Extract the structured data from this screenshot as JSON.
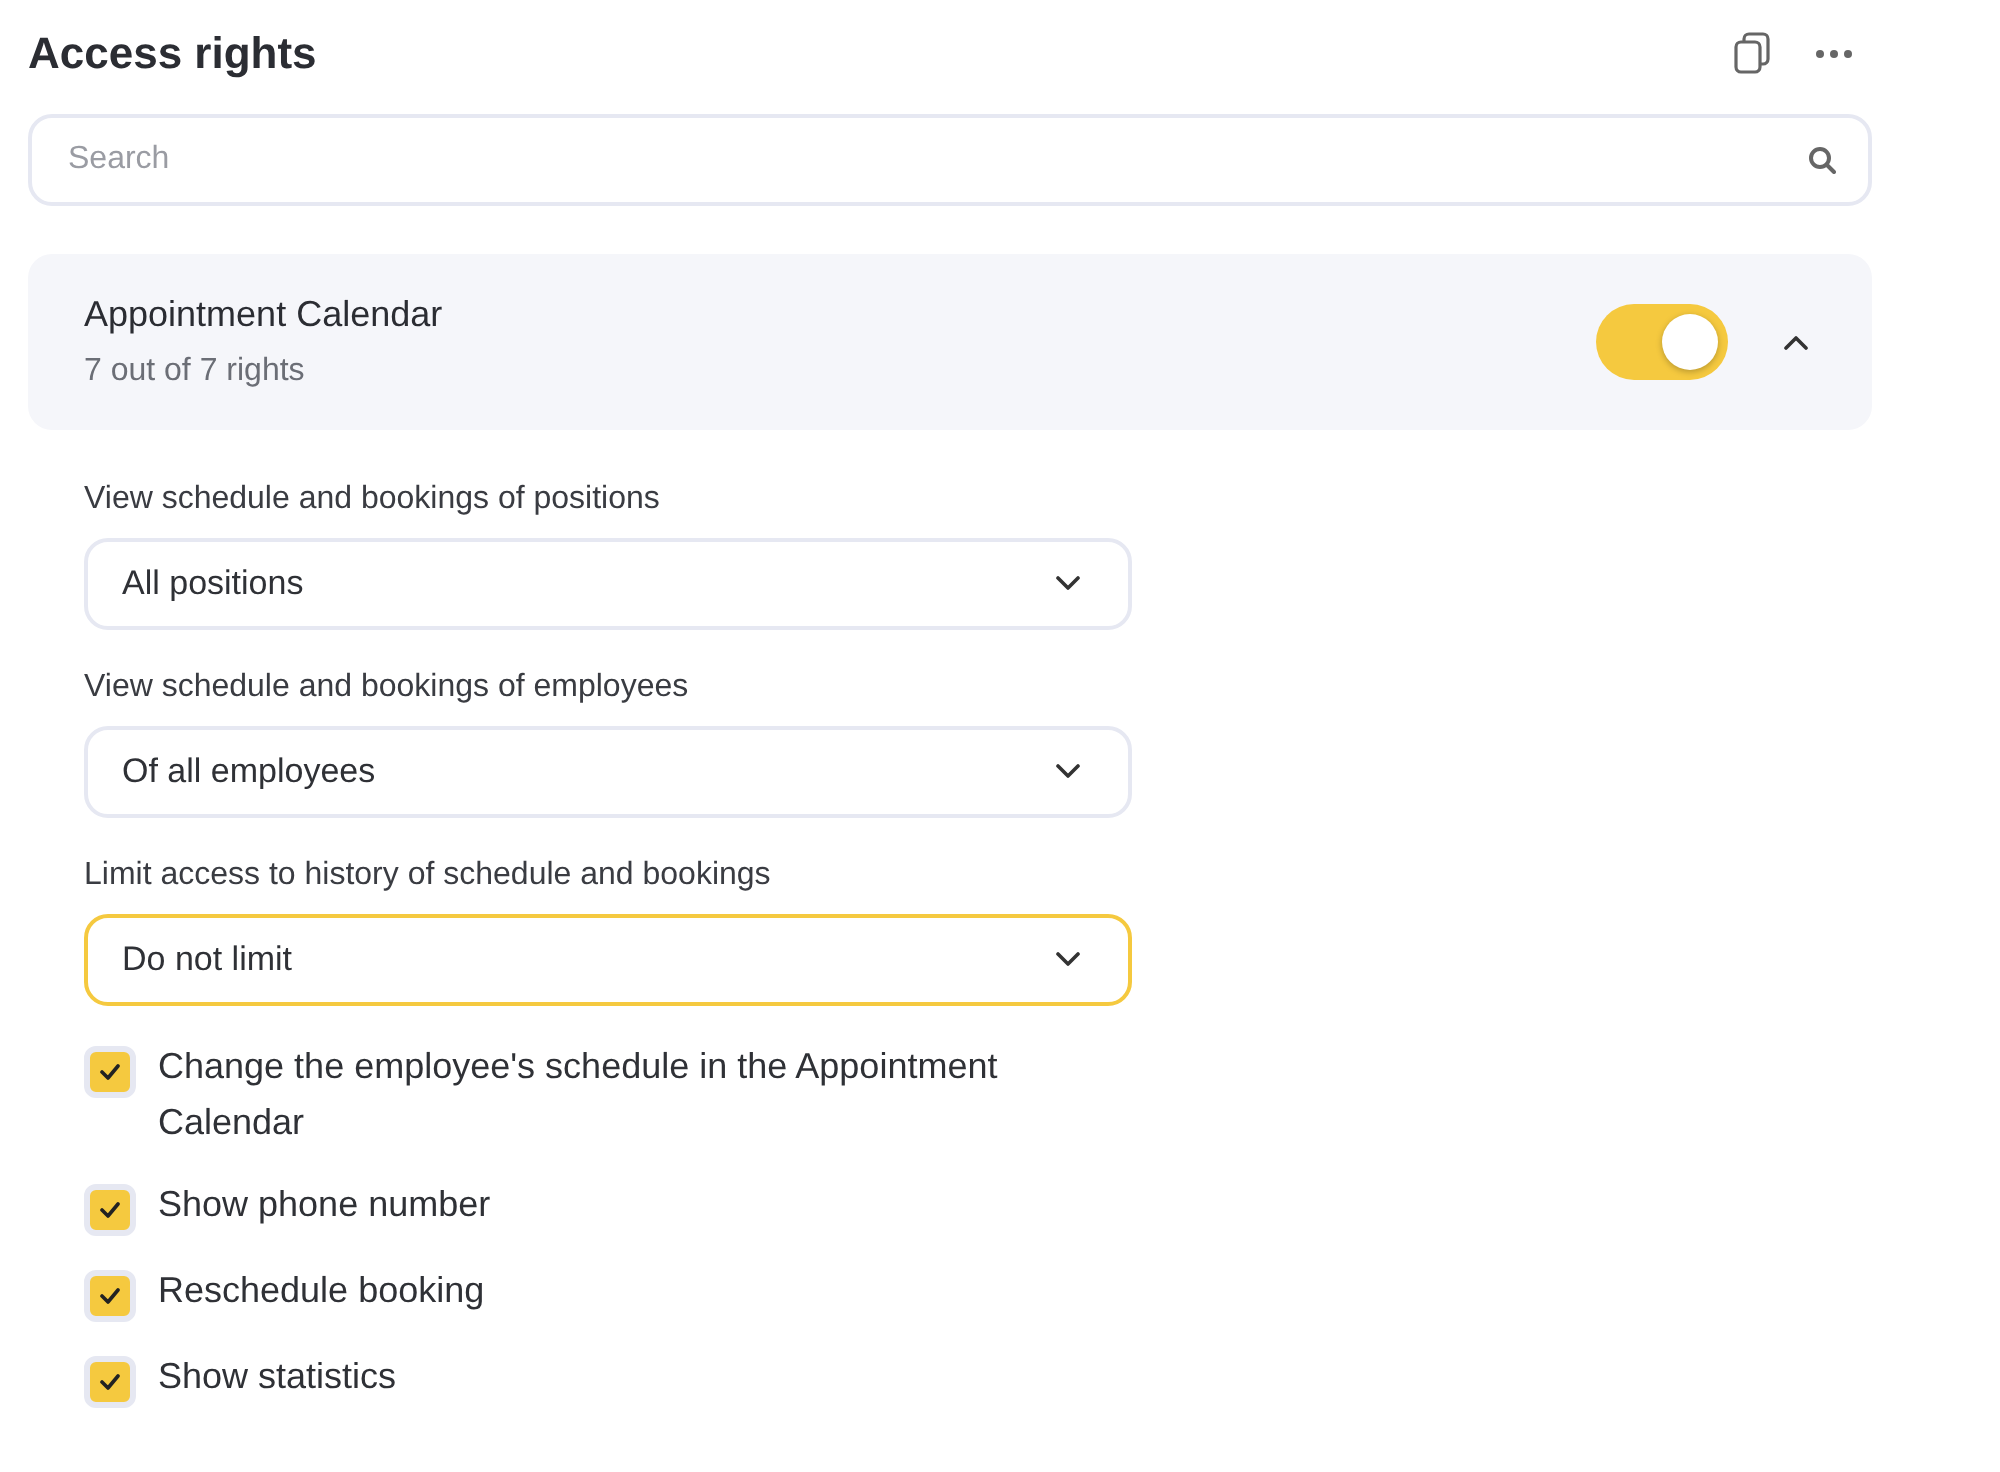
{
  "title": "Access rights",
  "search": {
    "placeholder": "Search"
  },
  "section": {
    "title": "Appointment Calendar",
    "subtitle": "7 out of 7 rights",
    "on": true,
    "expanded": true,
    "selects": [
      {
        "label": "View schedule and bookings of positions",
        "value": "All positions",
        "focused": false
      },
      {
        "label": "View schedule and bookings of employees",
        "value": "Of all employees",
        "focused": false
      },
      {
        "label": "Limit access to history of schedule and bookings",
        "value": "Do not limit",
        "focused": true
      }
    ],
    "checks": [
      {
        "label": "Change the employee's schedule in the Appointment Calendar",
        "checked": true
      },
      {
        "label": "Show phone number",
        "checked": true
      },
      {
        "label": "Reschedule booking",
        "checked": true
      },
      {
        "label": "Show statistics",
        "checked": true
      }
    ]
  }
}
